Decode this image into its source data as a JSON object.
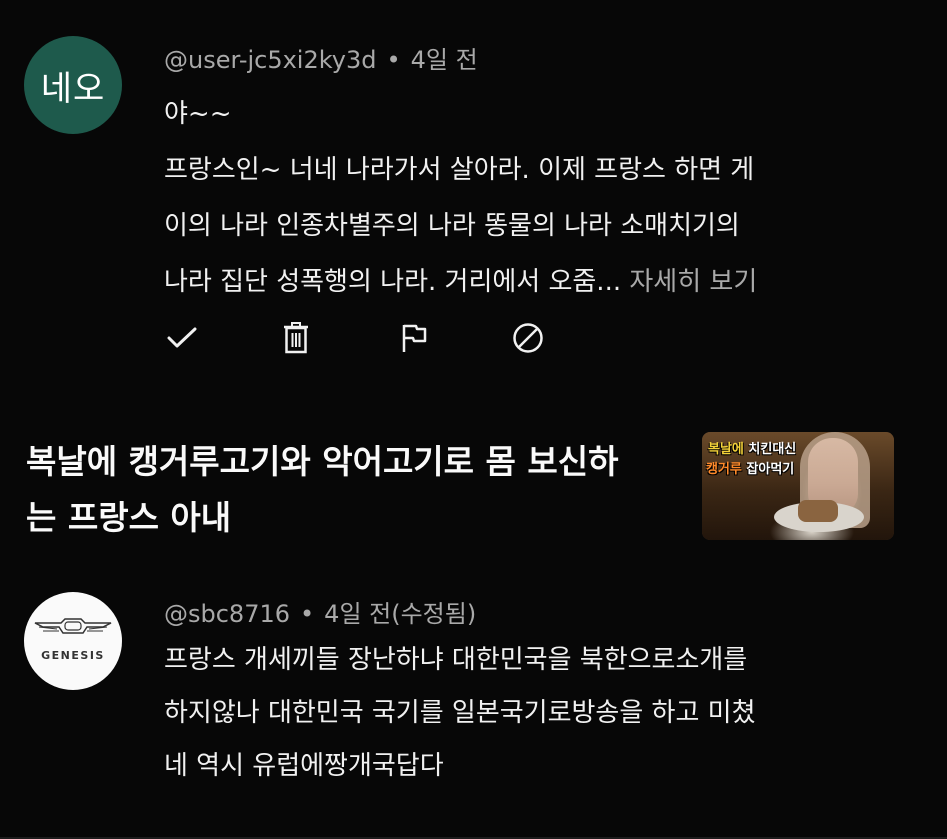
{
  "comments": [
    {
      "avatar_text": "네오",
      "avatar_color": "#1e5a4c",
      "author": "@user-jc5xi2ky3d",
      "time": "4일 전",
      "lines": [
        "야~~",
        "프랑스인~ 너네 나라가서 살아라. 이제 프랑스 하면 게",
        "이의 나라 인종차별주의 나라 똥물의 나라 소매치기의",
        "나라 집단 성폭행의 나라. 거리에서 오줌..."
      ],
      "more_label": "자세히 보기",
      "actions": [
        "check-icon",
        "trash-icon",
        "flag-icon",
        "block-icon"
      ]
    },
    {
      "avatar_logo_text": "GENESIS",
      "author": "@sbc8716",
      "time": "4일 전(수정됨)",
      "lines": [
        "프랑스 개세끼들 장난하냐 대한민국을 북한으로소개를",
        "하지않나 대한민국 국기를 일본국기로방송을 하고 미쳤",
        "네 역시 유럽에짱개국답다"
      ]
    }
  ],
  "video": {
    "title_line1": "복날에 캥거루고기와 악어고기로 몸 보신하",
    "title_line2": "는 프랑스 아내",
    "thumbnail": {
      "caption1_a": "복날에 ",
      "caption1_b": "치킨대신",
      "caption2_a": "캥거루 ",
      "caption2_b": "잡아먹기"
    }
  },
  "separator": "•",
  "colors": {
    "background": "#070707",
    "text": "#f1f1f1",
    "muted": "#a9a9a9"
  }
}
